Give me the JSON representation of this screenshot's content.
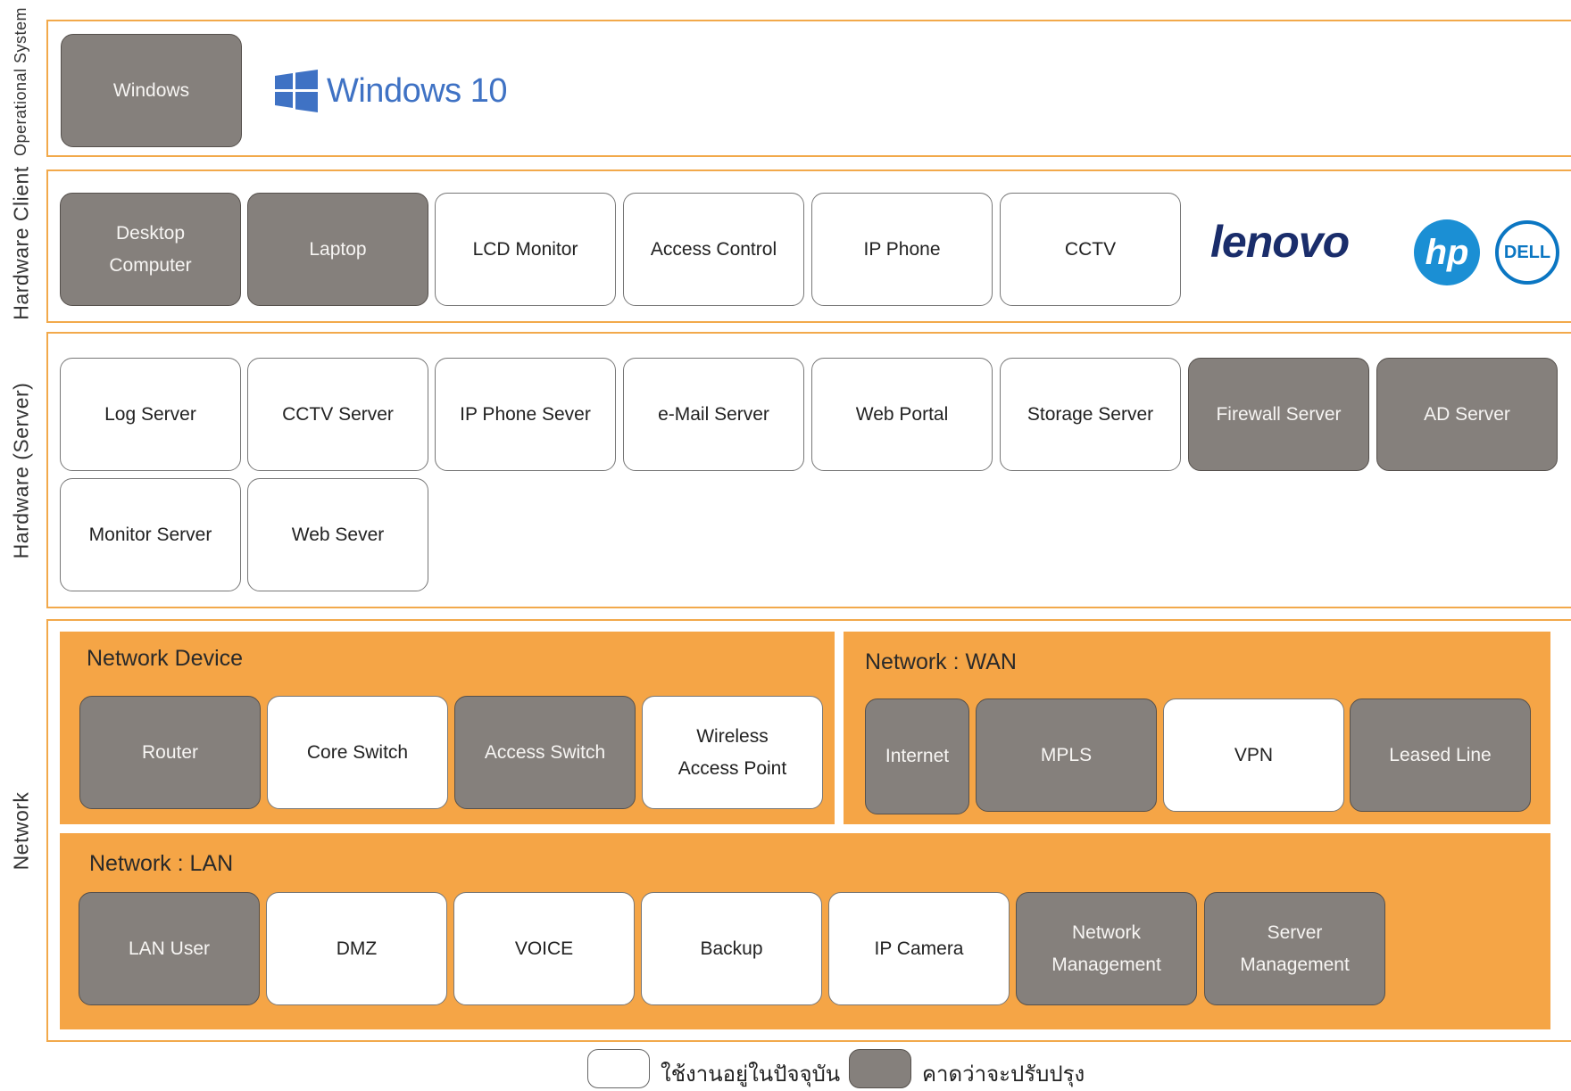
{
  "layers": {
    "os": {
      "label": "Operational System",
      "boxes": [
        {
          "label": "Windows",
          "status": "upgrade"
        }
      ],
      "brand": "Windows 10"
    },
    "client": {
      "label": "Hardware Client",
      "boxes": [
        {
          "label": "Desktop\nComputer",
          "status": "upgrade"
        },
        {
          "label": "Laptop",
          "status": "upgrade"
        },
        {
          "label": "LCD Monitor",
          "status": "current"
        },
        {
          "label": "Access Control",
          "status": "current"
        },
        {
          "label": "IP Phone",
          "status": "current"
        },
        {
          "label": "CCTV",
          "status": "current"
        }
      ],
      "brands": [
        "lenovo",
        "hp",
        "DELL"
      ]
    },
    "server": {
      "label": "Hardware (Server)",
      "boxes": [
        {
          "label": "Log Server",
          "status": "current"
        },
        {
          "label": "CCTV Server",
          "status": "current"
        },
        {
          "label": "IP Phone Sever",
          "status": "current"
        },
        {
          "label": "e-Mail Server",
          "status": "current"
        },
        {
          "label": "Web Portal",
          "status": "current"
        },
        {
          "label": "Storage Server",
          "status": "current"
        },
        {
          "label": "Firewall Server",
          "status": "upgrade"
        },
        {
          "label": "AD Server",
          "status": "upgrade"
        },
        {
          "label": "Monitor Server",
          "status": "current"
        },
        {
          "label": "Web Sever",
          "status": "current"
        }
      ]
    },
    "network": {
      "label": "Network",
      "device": {
        "title": "Network Device",
        "boxes": [
          {
            "label": "Router",
            "status": "upgrade"
          },
          {
            "label": "Core Switch",
            "status": "current"
          },
          {
            "label": "Access Switch",
            "status": "upgrade"
          },
          {
            "label": "Wireless\nAccess Point",
            "status": "current"
          }
        ]
      },
      "wan": {
        "title": "Network : WAN",
        "boxes": [
          {
            "label": "Internet",
            "status": "upgrade"
          },
          {
            "label": "MPLS",
            "status": "upgrade"
          },
          {
            "label": "VPN",
            "status": "current"
          },
          {
            "label": "Leased Line",
            "status": "upgrade"
          }
        ]
      },
      "lan": {
        "title": "Network : LAN",
        "boxes": [
          {
            "label": "LAN User",
            "status": "upgrade"
          },
          {
            "label": "DMZ",
            "status": "current"
          },
          {
            "label": "VOICE",
            "status": "current"
          },
          {
            "label": "Backup",
            "status": "current"
          },
          {
            "label": "IP Camera",
            "status": "current"
          },
          {
            "label": "Network\nManagement",
            "status": "upgrade"
          },
          {
            "label": "Server\nManagement",
            "status": "upgrade"
          }
        ]
      }
    }
  },
  "legend": {
    "current_label": "ใช้งานอยู่ในปัจจุบัน",
    "upgrade_label": "คาดว่าจะปรับปรุง"
  },
  "colors": {
    "band_border": "#f2a94b",
    "panel_fill": "#f5a546",
    "upgrade_fill": "#85807c",
    "current_fill": "#ffffff",
    "windows_blue": "#3f72c4",
    "lenovo_blue": "#1a2d6b",
    "hp_blue": "#1b8fd4",
    "dell_blue": "#0b76c2"
  }
}
